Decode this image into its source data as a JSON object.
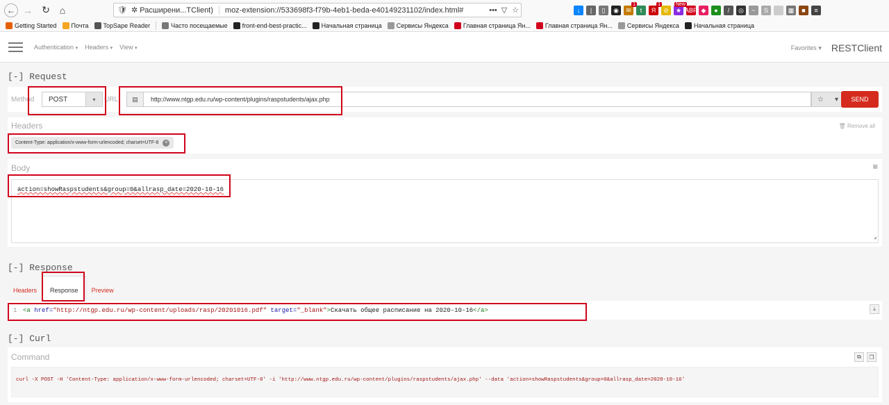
{
  "browser": {
    "tab_label": "Расширени...TClient)",
    "url": "moz-extension://533698f3-f79b-4eb1-beda-e40149231102/index.html#",
    "ellipsis": "•••",
    "badges": {
      "mail": "1",
      "yandex": "1",
      "new": "New",
      "abp": "ABP"
    }
  },
  "bookmarks": [
    {
      "label": "Getting Started",
      "color": "#e66000"
    },
    {
      "label": "Почта",
      "color": "#f5a623"
    },
    {
      "label": "TopSape Reader",
      "color": "#555555"
    },
    {
      "label": "Часто посещаемые",
      "color": "#777777"
    },
    {
      "label": "front-end-best-practic...",
      "color": "#222222"
    },
    {
      "label": "Начальная страница",
      "color": "#222222"
    },
    {
      "label": "Сервисы Яндекса",
      "color": "#999999"
    },
    {
      "label": "Главная страница Ян...",
      "color": "#d0021b"
    },
    {
      "label": "Главная страница Ян...",
      "color": "#d0021b"
    },
    {
      "label": "Сервисы Яндекса",
      "color": "#999999"
    },
    {
      "label": "Начальная страница",
      "color": "#222222"
    }
  ],
  "app_nav": {
    "menu": [
      "Authentication",
      "Headers",
      "View"
    ],
    "favorites": "Favorites",
    "brand": "RESTClient"
  },
  "request": {
    "section_title": "[-] Request",
    "method_label": "Method",
    "method_value": "POST",
    "url_label": "URL",
    "url_value": "http://www.ntgp.edu.ru/wp-content/plugins/raspstudents/ajax.php",
    "send_label": "SEND"
  },
  "headers": {
    "title": "Headers",
    "remove_all": "Remove all",
    "chip": "Content-Type: application/x-www-form-urlencoded; charset=UTF-8"
  },
  "body": {
    "title": "Body",
    "value": "action=showRaspstudents&group=0&allrasp_date=2020-10-16"
  },
  "response": {
    "section_title": "[-] Response",
    "tabs": [
      "Headers",
      "Response",
      "Preview"
    ],
    "line_no": "1",
    "code_tag_open": "<a",
    "code_attr_href": "href=",
    "code_href_val": "\"http://ntgp.edu.ru/wp-content/uploads/rasp/20201016.pdf\"",
    "code_attr_target": "target=",
    "code_target_val": "\"_blank\"",
    "code_gt": ">",
    "code_text": "Скачать общее расписание на 2020-10-16",
    "code_tag_close": "</a>"
  },
  "curl": {
    "section_title": "[-] Curl",
    "command_label": "Command",
    "command": "curl -X POST -H 'Content-Type: application/x-www-form-urlencoded; charset=UTF-8' -i 'http://www.ntgp.edu.ru/wp-content/plugins/raspstudents/ajax.php' --data 'action=showRaspstudents&group=0&allrasp_date=2020-10-16'"
  },
  "colors": {
    "accent": "#d52b1e",
    "highlight": "#d0021b"
  }
}
